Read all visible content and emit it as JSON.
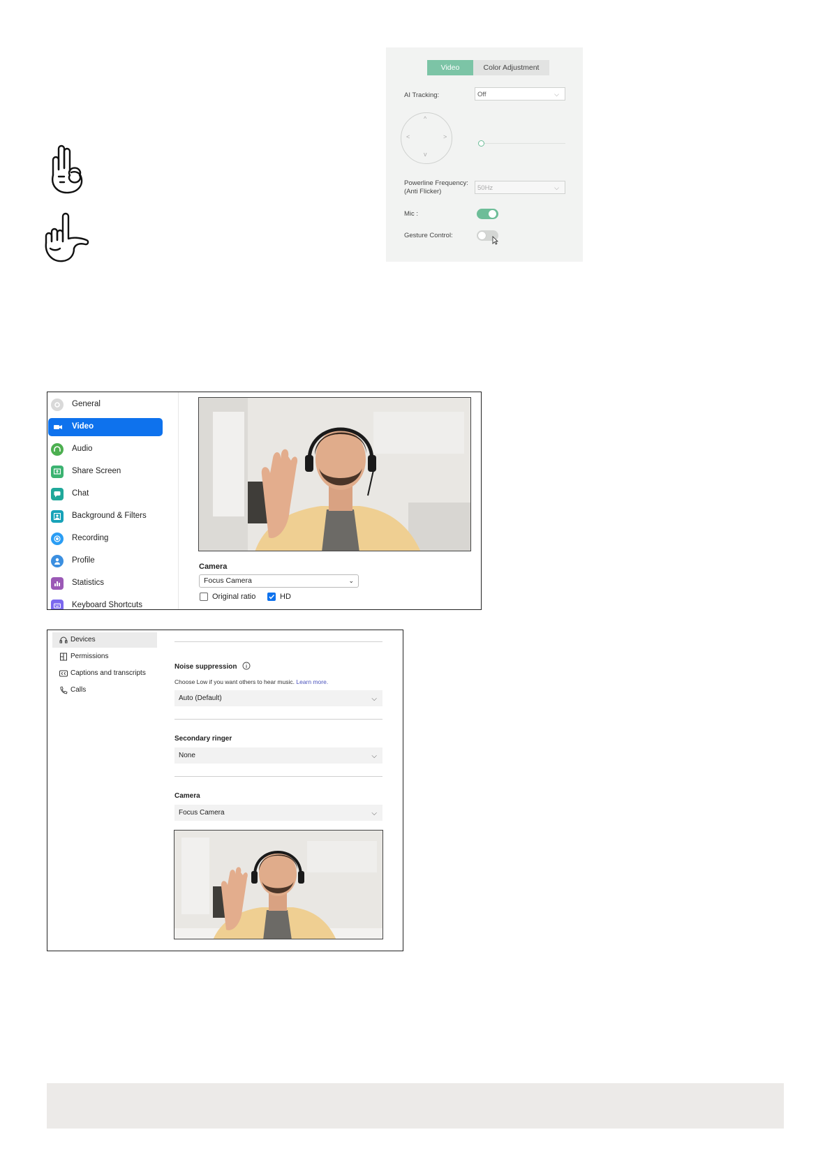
{
  "camera_app": {
    "tabs": [
      {
        "label": "Video",
        "active": true
      },
      {
        "label": "Color Adjustment",
        "active": false
      }
    ],
    "ai_tracking": {
      "label": "AI Tracking:",
      "value": "Off"
    },
    "powerline": {
      "label_line1": "Powerline Frequency:",
      "label_line2": "(Anti Flicker)",
      "value": "50Hz"
    },
    "mic": {
      "label": "Mic :",
      "on": true
    },
    "gesture_control": {
      "label": "Gesture Control:",
      "on": false
    },
    "accent_color": "#7cc4a6"
  },
  "zoom_settings": {
    "sidebar": [
      {
        "label": "General",
        "icon": "gear-icon",
        "color": "#d9d9d9"
      },
      {
        "label": "Video",
        "icon": "video-camera-icon",
        "color": "#0e72ed",
        "active": true
      },
      {
        "label": "Audio",
        "icon": "headphones-icon",
        "color": "#4caf50"
      },
      {
        "label": "Share Screen",
        "icon": "share-screen-icon",
        "color": "#3cb371"
      },
      {
        "label": "Chat",
        "icon": "chat-icon",
        "color": "#1fa89a"
      },
      {
        "label": "Background & Filters",
        "icon": "background-icon",
        "color": "#17a2b8"
      },
      {
        "label": "Recording",
        "icon": "recording-icon",
        "color": "#2a9df4"
      },
      {
        "label": "Profile",
        "icon": "profile-icon",
        "color": "#3b8fe0"
      },
      {
        "label": "Statistics",
        "icon": "statistics-icon",
        "color": "#9b59b6"
      },
      {
        "label": "Keyboard Shortcuts",
        "icon": "keyboard-icon",
        "color": "#7b68ee"
      }
    ],
    "camera_label": "Camera",
    "camera_value": "Focus Camera",
    "original_ratio": {
      "label": "Original ratio",
      "checked": false
    },
    "hd": {
      "label": "HD",
      "checked": true
    }
  },
  "teams_settings": {
    "sidebar": [
      {
        "label": "Devices",
        "icon": "devices-icon",
        "active": true
      },
      {
        "label": "Permissions",
        "icon": "permissions-icon"
      },
      {
        "label": "Captions and transcripts",
        "icon": "captions-icon"
      },
      {
        "label": "Calls",
        "icon": "phone-icon"
      }
    ],
    "noise": {
      "label": "Noise suppression",
      "note": "Choose Low if you want others to hear music.",
      "link": "Learn more.",
      "value": "Auto (Default)"
    },
    "secondary_ringer": {
      "label": "Secondary ringer",
      "value": "None"
    },
    "camera": {
      "label": "Camera",
      "value": "Focus Camera"
    }
  }
}
